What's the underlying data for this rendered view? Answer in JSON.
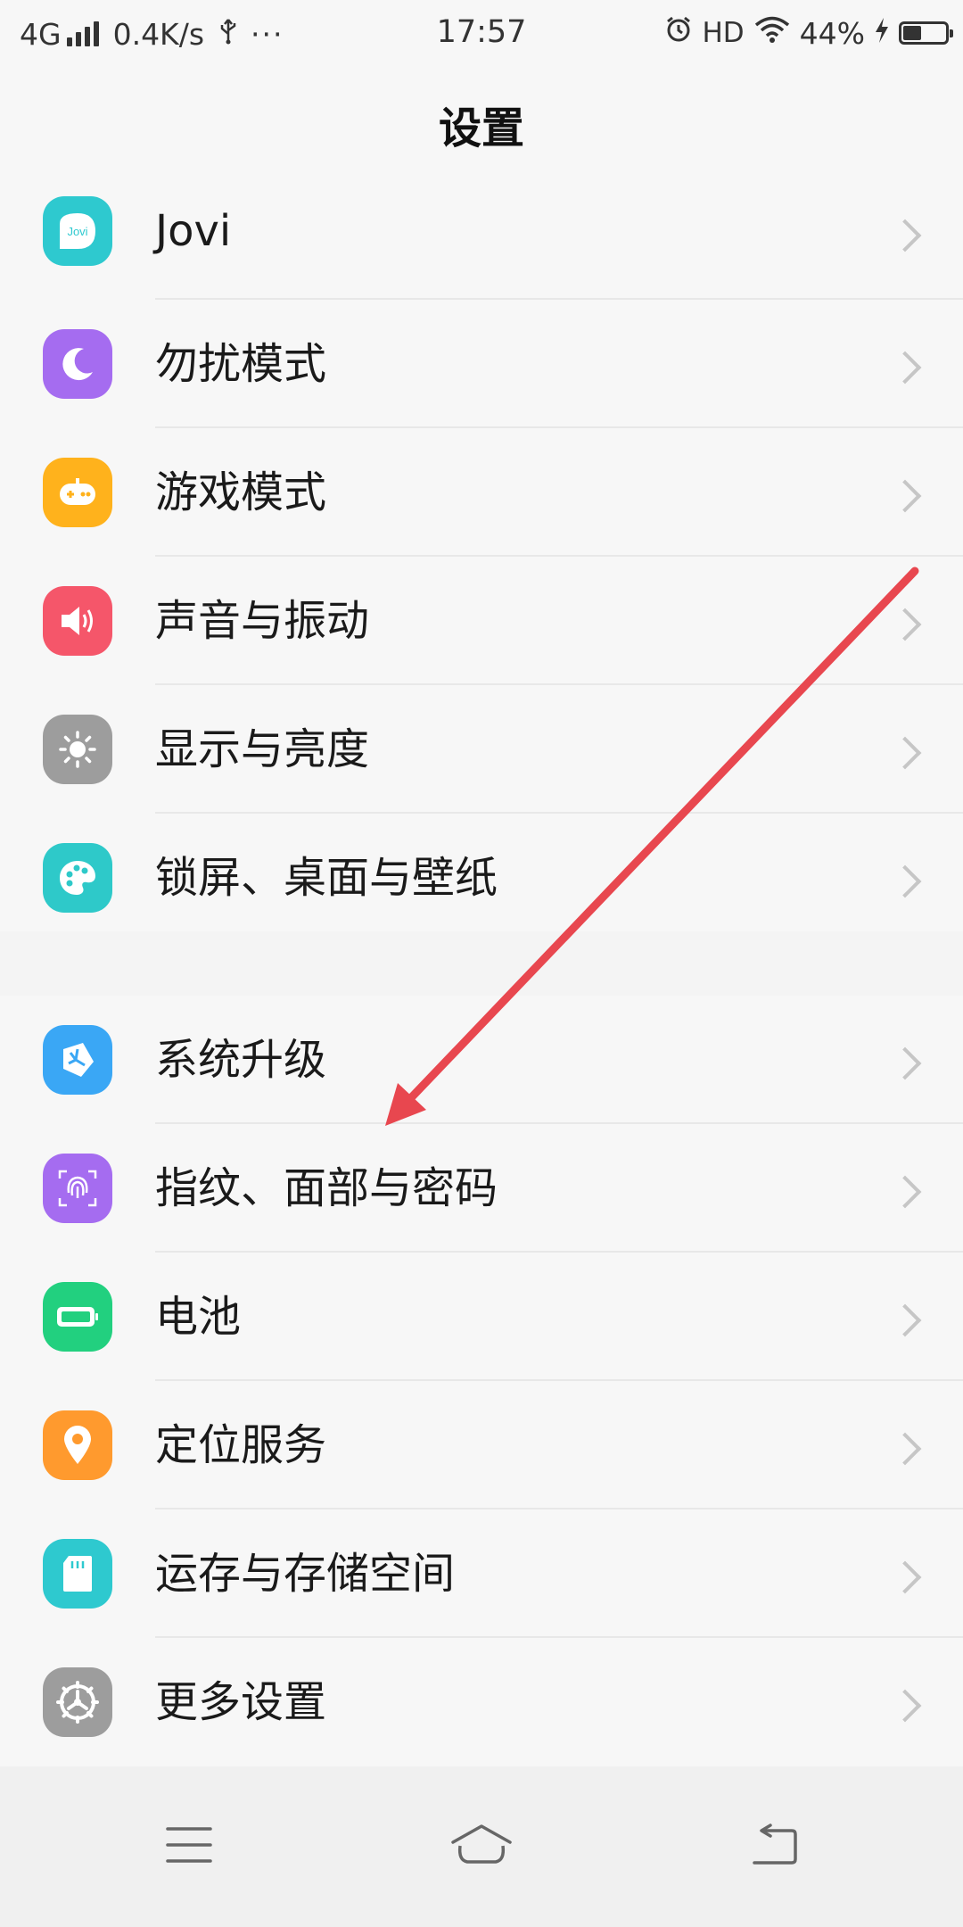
{
  "status_bar": {
    "network": "4G",
    "speed": "0.4K/s",
    "usb_icon": "usb-icon",
    "more": "···",
    "time": "17:57",
    "alarm_icon": "alarm-icon",
    "hd": "HD",
    "wifi_icon": "wifi-icon",
    "battery_percent": "44%",
    "battery_level": 0.44,
    "charging_icon": "charging-bolt-icon"
  },
  "header": {
    "title": "设置"
  },
  "groups": [
    {
      "items": [
        {
          "label": "Jovi",
          "icon": "jovi-icon",
          "color": "#2ec9cf"
        },
        {
          "label": "勿扰模式",
          "icon": "moon-icon",
          "color": "#a56cf0"
        },
        {
          "label": "游戏模式",
          "icon": "gamepad-icon",
          "color": "#ffb21c"
        },
        {
          "label": "声音与振动",
          "icon": "speaker-icon",
          "color": "#f5566a"
        },
        {
          "label": "显示与亮度",
          "icon": "sun-icon",
          "color": "#9d9d9d"
        },
        {
          "label": "锁屏、桌面与壁纸",
          "icon": "palette-icon",
          "color": "#2ec9c9"
        }
      ]
    },
    {
      "items": [
        {
          "label": "系统升级",
          "icon": "system-update-icon",
          "color": "#3aa7f5"
        },
        {
          "label": "指纹、面部与密码",
          "icon": "fingerprint-icon",
          "color": "#a56cf0"
        },
        {
          "label": "电池",
          "icon": "battery-icon",
          "color": "#22d07f"
        },
        {
          "label": "定位服务",
          "icon": "location-pin-icon",
          "color": "#ff9a2e"
        },
        {
          "label": "运存与存储空间",
          "icon": "sd-card-icon",
          "color": "#2ec9cf"
        },
        {
          "label": "更多设置",
          "icon": "more-settings-gear-icon",
          "color": "#9d9d9d"
        }
      ]
    }
  ],
  "nav": {
    "menu_icon": "menu-icon",
    "home_icon": "home-icon",
    "back_icon": "back-icon"
  },
  "annotation": {
    "arrow_color": "#e8474f",
    "points_to": "指纹、面部与密码"
  }
}
